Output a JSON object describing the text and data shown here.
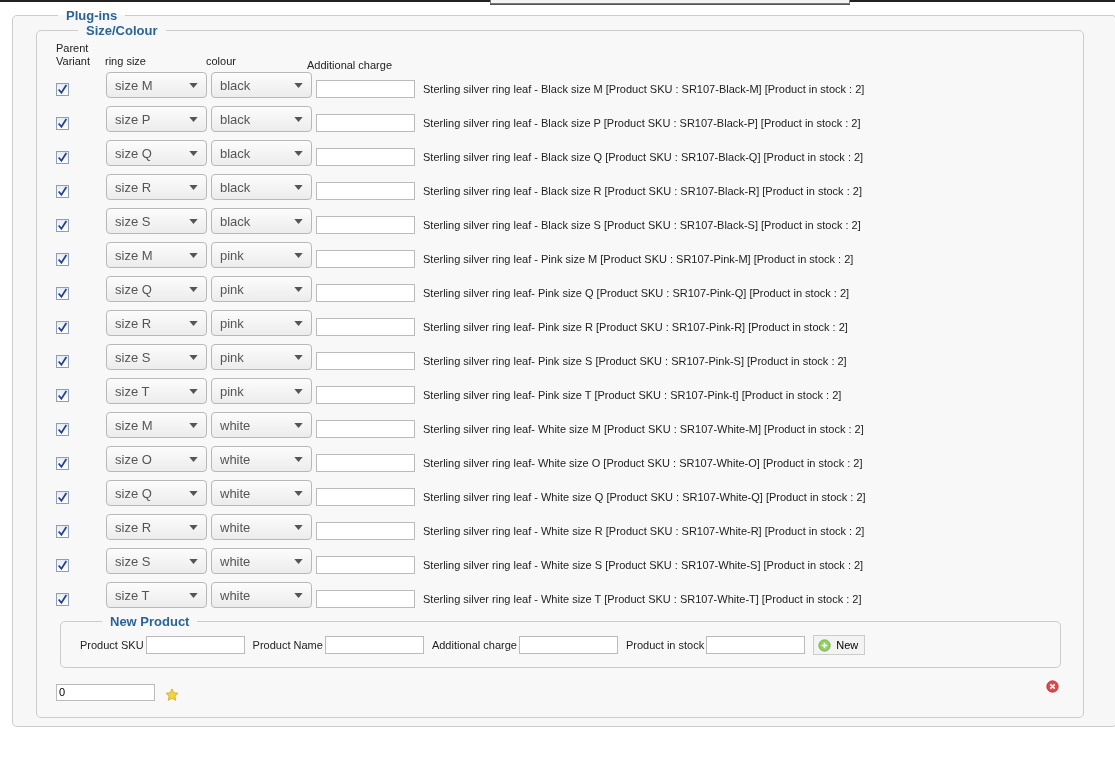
{
  "plugins": {
    "title": "Plug-ins"
  },
  "section": {
    "title": "Size/Colour",
    "columns": [
      "Parent Variant",
      "ring size",
      "colour",
      "Additional charge"
    ],
    "rows": [
      {
        "parent_variant": true,
        "ring_size": "size M",
        "colour": "black",
        "description": "Sterling silver ring leaf - Black size M [Product SKU : SR107-Black-M] [Product in stock : 2]"
      },
      {
        "parent_variant": true,
        "ring_size": "size P",
        "colour": "black",
        "description": "Sterling silver ring leaf - Black size P [Product SKU : SR107-Black-P] [Product in stock : 2]"
      },
      {
        "parent_variant": true,
        "ring_size": "size Q",
        "colour": "black",
        "description": "Sterling silver ring leaf - Black size Q [Product SKU : SR107-Black-Q] [Product in stock : 2]"
      },
      {
        "parent_variant": true,
        "ring_size": "size R",
        "colour": "black",
        "description": "Sterling silver ring leaf - Black size R [Product SKU : SR107-Black-R] [Product in stock : 2]"
      },
      {
        "parent_variant": true,
        "ring_size": "size S",
        "colour": "black",
        "description": "Sterling silver ring leaf - Black size S [Product SKU : SR107-Black-S] [Product in stock : 2]"
      },
      {
        "parent_variant": true,
        "ring_size": "size M",
        "colour": "pink",
        "description": "Sterling silver ring leaf - Pink size M [Product SKU : SR107-Pink-M] [Product in stock : 2]"
      },
      {
        "parent_variant": true,
        "ring_size": "size Q",
        "colour": "pink",
        "description": "Sterling silver ring leaf- Pink size Q [Product SKU : SR107-Pink-Q] [Product in stock : 2]"
      },
      {
        "parent_variant": true,
        "ring_size": "size R",
        "colour": "pink",
        "description": "Sterling silver ring leaf- Pink size R [Product SKU : SR107-Pink-R] [Product in stock : 2]"
      },
      {
        "parent_variant": true,
        "ring_size": "size S",
        "colour": "pink",
        "description": "Sterling silver ring leaf- Pink size S [Product SKU : SR107-Pink-S] [Product in stock : 2]"
      },
      {
        "parent_variant": true,
        "ring_size": "size T",
        "colour": "pink",
        "description": "Sterling silver ring leaf- Pink size T [Product SKU : SR107-Pink-t] [Product in stock : 2]"
      },
      {
        "parent_variant": true,
        "ring_size": "size M",
        "colour": "white",
        "description": "Sterling silver ring leaf- White size M [Product SKU : SR107-White-M] [Product in stock : 2]"
      },
      {
        "parent_variant": true,
        "ring_size": "size O",
        "colour": "white",
        "description": "Sterling silver ring leaf- White size O [Product SKU : SR107-White-O] [Product in stock : 2]"
      },
      {
        "parent_variant": true,
        "ring_size": "size Q",
        "colour": "white",
        "description": "Sterling silver ring leaf - White size Q [Product SKU : SR107-White-Q] [Product in stock : 2]"
      },
      {
        "parent_variant": true,
        "ring_size": "size R",
        "colour": "white",
        "description": "Sterling silver ring leaf - White size R [Product SKU : SR107-White-R] [Product in stock : 2]"
      },
      {
        "parent_variant": true,
        "ring_size": "size S",
        "colour": "white",
        "description": "Sterling silver ring leaf - White size S [Product SKU : SR107-White-S] [Product in stock : 2]"
      },
      {
        "parent_variant": true,
        "ring_size": "size T",
        "colour": "white",
        "description": "Sterling silver ring leaf - White size T [Product SKU : SR107-White-T] [Product in stock : 2]"
      }
    ],
    "new_product": {
      "title": "New Product",
      "fields": [
        {
          "label": "Product SKU"
        },
        {
          "label": "Product Name"
        },
        {
          "label": "Additional charge"
        },
        {
          "label": "Product in stock"
        }
      ],
      "button": "New"
    },
    "ordering": {
      "value": "0"
    }
  }
}
